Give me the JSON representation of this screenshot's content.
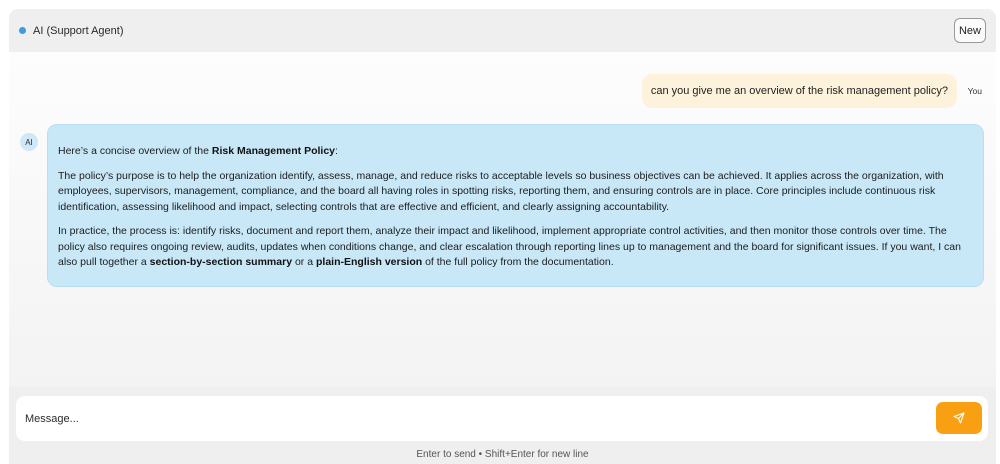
{
  "header": {
    "title": "AI (Support Agent)",
    "status_color": "#3d9be0",
    "new_label": "New"
  },
  "messages": {
    "user": {
      "text": "can you give me an overview of the risk management policy?",
      "sender_label": "You"
    },
    "assistant": {
      "avatar_label": "AI",
      "intro_prefix": "Here’s a concise overview of the ",
      "intro_bold": "Risk Management Policy",
      "intro_suffix": ":",
      "paragraph_1": "The policy’s purpose is to help the organization identify, assess, manage, and reduce risks to acceptable levels so business objectives can be achieved. It applies across the organization, with employees, supervisors, management, compliance, and the board all having roles in spotting risks, reporting them, and ensuring controls are in place. Core principles include continuous risk identification, assessing likelihood and impact, selecting controls that are effective and efficient, and clearly assigning accountability.",
      "paragraph_2_text": "In practice, the process is: identify risks, document and report them, analyze their impact and likelihood, implement appropriate control activities, and then monitor those controls over time. The policy also requires ongoing review, audits, updates when conditions change, and clear escalation through reporting lines up to management and the board for significant issues. If you want, I can also pull together a ",
      "paragraph_2_bold_1": "section-by-section summary",
      "paragraph_2_mid": " or a ",
      "paragraph_2_bold_2": "plain-English version",
      "paragraph_2_end": " of the full policy from the documentation."
    }
  },
  "composer": {
    "placeholder": "Message...",
    "send_icon": "send-icon",
    "accent_color": "#f9a012",
    "hint": "Enter to send • Shift+Enter for new line"
  }
}
